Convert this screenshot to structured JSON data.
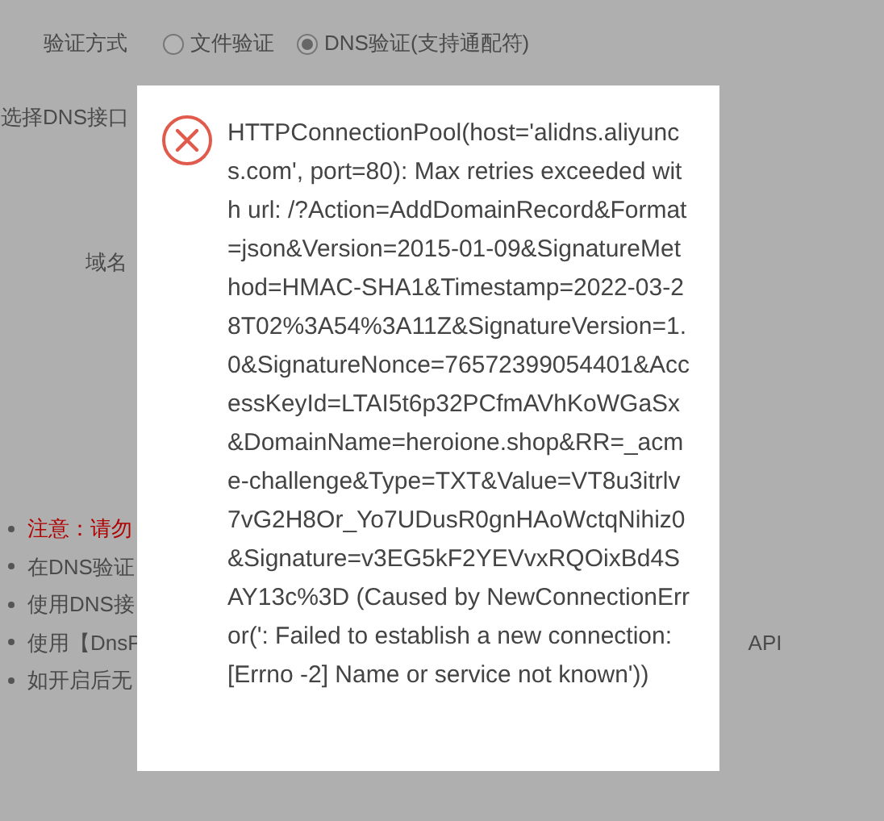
{
  "form": {
    "verify_method": {
      "label": "验证方式",
      "options": [
        {
          "label": "文件验证",
          "selected": false
        },
        {
          "label": "DNS验证(支持通配符)",
          "selected": true
        }
      ]
    },
    "dns_api": {
      "label": "选择DNS接口"
    },
    "domain": {
      "label": "域名"
    }
  },
  "notes": [
    {
      "text": "注意：请勿",
      "kind": "warning"
    },
    {
      "text": "在DNS验证",
      "kind": "info"
    },
    {
      "text": "使用DNS接",
      "kind": "info"
    },
    {
      "text": "使用【DnsP",
      "kind": "info",
      "tail": "API"
    },
    {
      "text": "如开启后无",
      "kind": "info"
    }
  ],
  "dialog": {
    "kind": "error",
    "message": "HTTPConnectionPool(host='alidns.aliyuncs.com', port=80): Max retries exceeded with url: /?Action=AddDomainRecord&Format=json&Version=2015-01-09&SignatureMethod=HMAC-SHA1&Timestamp=2022-03-28T02%3A54%3A11Z&SignatureVersion=1.0&SignatureNonce=76572399054401&AccessKeyId=LTAI5t6p32PCfmAVhKoWGaSx&DomainName=heroione.shop&RR=_acme-challenge&Type=TXT&Value=VT8u3itrlv7vG2H8Or_Yo7UDusR0gnHAoWctqNihiz0&Signature=v3EG5kF2YEVvxRQOixBd4SAY13c%3D (Caused by NewConnectionError(': Failed to establish a new connection: [Errno -2] Name or service not known'))"
  }
}
